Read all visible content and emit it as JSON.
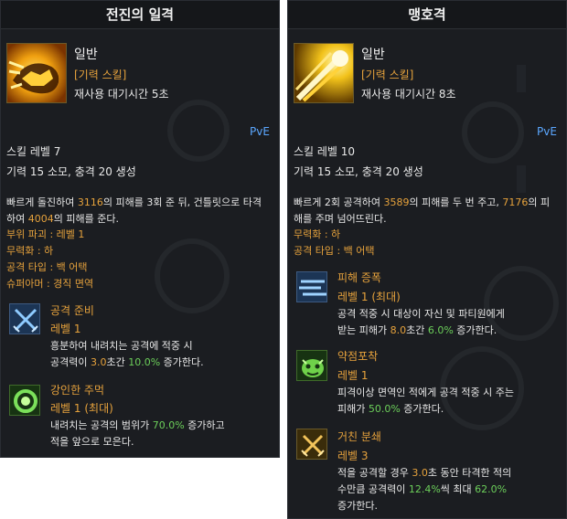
{
  "left": {
    "title": "전진의 일격",
    "grade": "일반",
    "skill_type": "[기력 스킬]",
    "cooldown": "재사용 대기시간 5초",
    "pve": "PvE",
    "skill_level": "스킬 레벨 7",
    "cost": "기력 15 소모, 충격 20 생성",
    "desc": {
      "l1a": "빠르게 돌진하여 ",
      "l1n1": "3116",
      "l1b": "의 피해를 3회 준 뒤, 건틀릿으로 타격",
      "l2a": "하여 ",
      "l2n1": "4004",
      "l2b": "의 피해를 준다."
    },
    "props": [
      "부위 파괴 : 레벨 1",
      "무력화 : 하",
      "공격 타입 : 백 어택",
      "슈퍼아머 : 경직 면역"
    ],
    "tripods": [
      {
        "icon": "crossed-swords-icon",
        "name": "공격 준비",
        "level": "레벨 1",
        "d1": "흥분하여 내려치는 공격에 적중 시",
        "d2a": "공격력이 ",
        "d2n1": "3.0",
        "d2b": "초간 ",
        "d2n2": "10.0%",
        "d2c": " 증가한다."
      },
      {
        "icon": "swirl-icon",
        "name": "강인한 주먹",
        "level": "레벨 1 (최대)",
        "d1a": "내려치는 공격의 범위가 ",
        "d1n1": "70.0%",
        "d1b": " 증가하고",
        "d2": "적을 앞으로 모은다."
      }
    ]
  },
  "right": {
    "title": "맹호격",
    "grade": "일반",
    "skill_type": "[기력 스킬]",
    "cooldown": "재사용 대기시간 8초",
    "pve": "PvE",
    "skill_level": "스킬 레벨 10",
    "cost": "기력 15 소모, 충격 20 생성",
    "desc": {
      "l1a": "빠르게 2회 공격하여 ",
      "l1n1": "3589",
      "l1b": "의 피해를 두 번 주고, ",
      "l1n2": "7176",
      "l1c": "의 피",
      "l2": "해를 주며 넘어뜨린다."
    },
    "props": [
      "무력화 : 하",
      "공격 타입 : 백 어택"
    ],
    "tripods": [
      {
        "icon": "speed-lines-icon",
        "name": "피해 증폭",
        "level": "레벨 1 (최대)",
        "d1": "공격 적중 시 대상이 자신 및 파티원에게",
        "d2a": "받는 피해가 ",
        "d2n1": "8.0",
        "d2b": "초간 ",
        "d2n2": "6.0%",
        "d2c": " 증가한다."
      },
      {
        "icon": "monster-face-icon",
        "name": "약점포착",
        "level": "레벨 1",
        "d1": "피격이상 면역인 적에게 공격 적중 시 주는",
        "d2a": "피해가 ",
        "d2n1": "50.0%",
        "d2b": " 증가한다."
      },
      {
        "icon": "crossed-swords-icon",
        "name": "거친 분쇄",
        "level": "레벨 3",
        "d1a": "적을 공격할 경우 ",
        "d1n1": "3.0",
        "d1b": "초 동안 타격한 적의",
        "d2a": "수만큼 공격력이 ",
        "d2n1": "12.4%",
        "d2b": "씩 최대 ",
        "d2n2": "62.0%",
        "d3": "증가한다."
      }
    ]
  }
}
